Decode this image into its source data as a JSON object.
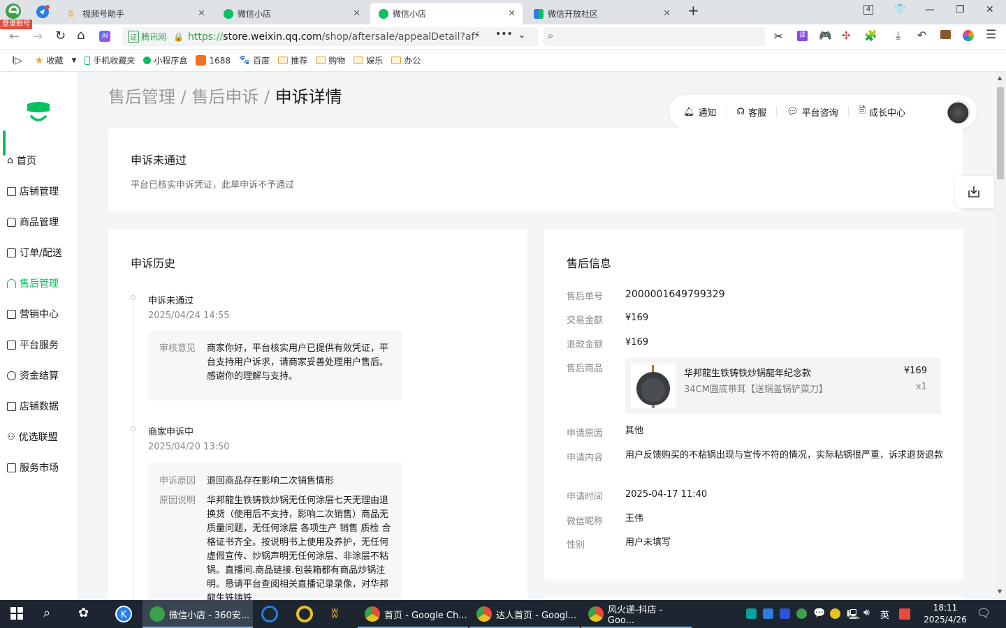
{
  "browser": {
    "login_badge": "登录账号",
    "tabs": [
      {
        "label": "视频号助手",
        "active": false
      },
      {
        "label": "微信小店",
        "active": false
      },
      {
        "label": "微信小店",
        "active": true
      },
      {
        "label": "微信开放社区",
        "active": false
      }
    ],
    "tab_count": "4",
    "url_secure_label": "腾讯网",
    "url_prefix": "https://",
    "url_host": "store.weixin.qq.com",
    "url_path": "/shop/aftersale/appealDetail?af",
    "bookmarks": [
      {
        "label": "收藏",
        "icon": "star-icon"
      },
      {
        "label": "手机收藏夹",
        "icon": "phone-icon"
      },
      {
        "label": "小程序盒",
        "icon": "miniprogram-icon"
      },
      {
        "label": "1688",
        "icon": "1688-icon"
      },
      {
        "label": "百度",
        "icon": "baidu-icon"
      },
      {
        "label": "推荐",
        "icon": "folder-icon"
      },
      {
        "label": "购物",
        "icon": "folder-icon"
      },
      {
        "label": "娱乐",
        "icon": "folder-icon"
      },
      {
        "label": "办公",
        "icon": "folder-icon"
      }
    ]
  },
  "sidebar": {
    "items": [
      {
        "label": "首页",
        "icon": "home-icon"
      },
      {
        "label": "店铺管理",
        "icon": "store-icon"
      },
      {
        "label": "商品管理",
        "icon": "bag-icon"
      },
      {
        "label": "订单/配送",
        "icon": "order-icon"
      },
      {
        "label": "售后管理",
        "icon": "headset-icon",
        "active": true
      },
      {
        "label": "营销中心",
        "icon": "marketing-icon"
      },
      {
        "label": "平台服务",
        "icon": "service-icon"
      },
      {
        "label": "资金结算",
        "icon": "money-icon"
      },
      {
        "label": "店铺数据",
        "icon": "chart-icon"
      },
      {
        "label": "优选联盟",
        "icon": "alliance-icon"
      },
      {
        "label": "服务市场",
        "icon": "market-icon"
      }
    ]
  },
  "breadcrumb": {
    "level1": "售后管理",
    "sep": " / ",
    "level2": "售后申诉",
    "current": "申诉详情"
  },
  "topnav": {
    "notify": "通知",
    "support": "客服",
    "consult": "平台咨询",
    "growth": "成长中心"
  },
  "status": {
    "title": "申诉未通过",
    "desc": "平台已核实申诉凭证，此单申诉不予通过"
  },
  "history": {
    "title": "申诉历史",
    "entries": [
      {
        "title": "申诉未通过",
        "time": "2025/04/24 14:55",
        "fields": [
          {
            "key": "审核意见",
            "value": "商家你好，平台核实用户已提供有效凭证，平台支持用户诉求，请商家妥善处理用户售后。感谢你的理解与支持。"
          }
        ]
      },
      {
        "title": "商家申诉中",
        "time": "2025/04/20 13:50",
        "fields": [
          {
            "key": "申诉原因",
            "value": "退回商品存在影响二次销售情形"
          },
          {
            "key": "原因说明",
            "value": "华邦龍生铁铸铁炒锅无任何涂层七天无理由退换货（使用后不支持，影响二次销售）商品无质量问题，无任何涂层 各项生产 销售 质检 合格证书齐全。按说明书上使用及养护，无任何虚假宣传、炒锅声明无任何涂层、非涂层不粘锅。直播间.商品链接.包装箱都有商品炒锅注明。恳请平台查阅相关直播记录录像，对华邦龍生铁铸铁"
          }
        ]
      }
    ]
  },
  "aftersale": {
    "title": "售后信息",
    "order_no_label": "售后单号",
    "order_no": "2000001649799329",
    "trade_amount_label": "交易金额",
    "trade_amount": "¥169",
    "refund_amount_label": "退款金额",
    "refund_amount": "¥169",
    "goods_label": "售后商品",
    "goods": {
      "name": "华邦龍生铁铸铁炒锅龍年纪念款",
      "spec": "34CM圆底带耳【送锅盖锅铲菜刀】",
      "price": "¥169",
      "qty": "x1"
    },
    "reason_label": "申请原因",
    "reason": "其他",
    "content_label": "申请内容",
    "content": "用户反馈购买的不粘锅出现与宣传不符的情况，实际粘锅很严重，诉求退货退款",
    "time_label": "申请时间",
    "time": "2025-04-17 11:40",
    "nickname_label": "微信昵称",
    "nickname": "王伟",
    "gender_label": "性别",
    "gender": "用户未填写"
  },
  "taskbar": {
    "apps": [
      {
        "label": "微信小店 - 360安...",
        "active": true
      },
      {
        "label": "首页 - Google Ch..."
      },
      {
        "label": "达人首页 - Googl..."
      },
      {
        "label": "风火递-抖店 - Goo..."
      }
    ],
    "ime": "英",
    "clock_time": "18:11",
    "clock_date": "2025/4/26"
  },
  "colors": {
    "accent": "#07c160",
    "browser_green": "#3aa14a",
    "taskbar": "#1d2630"
  }
}
